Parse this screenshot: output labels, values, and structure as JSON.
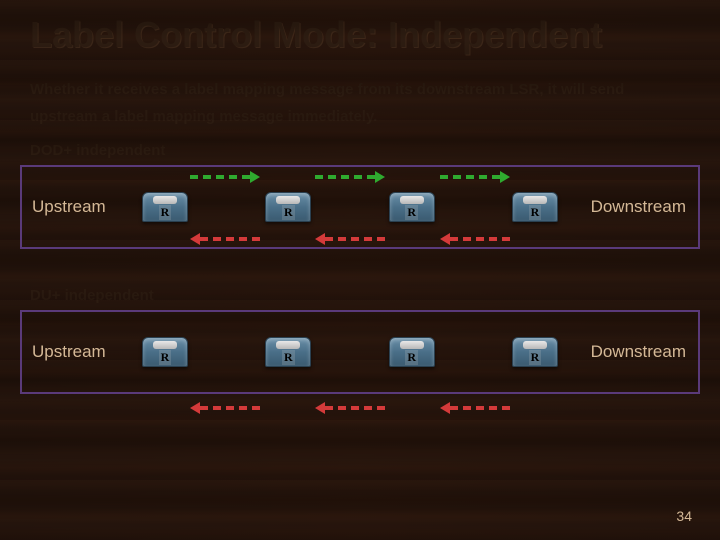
{
  "title": "Label Control Mode: Independent",
  "description": "Whether it receives a label mapping message from its downstream LSR, it will send upstream a label mapping message immediately.",
  "sections": [
    {
      "label": "DOD+ independent",
      "upstream_label": "Upstream",
      "downstream_label": "Downstream",
      "routers": [
        "R",
        "R",
        "R",
        "R"
      ],
      "top_arrows": {
        "direction": "right",
        "color": "green",
        "count": 3
      },
      "bottom_arrows": {
        "direction": "left",
        "color": "red",
        "count": 3
      }
    },
    {
      "label": "DU+ independent",
      "upstream_label": "Upstream",
      "downstream_label": "Downstream",
      "routers": [
        "R",
        "R",
        "R",
        "R"
      ],
      "top_arrows": null,
      "bottom_arrows": {
        "direction": "left",
        "color": "red",
        "count": 3
      }
    }
  ],
  "page_number": "34"
}
